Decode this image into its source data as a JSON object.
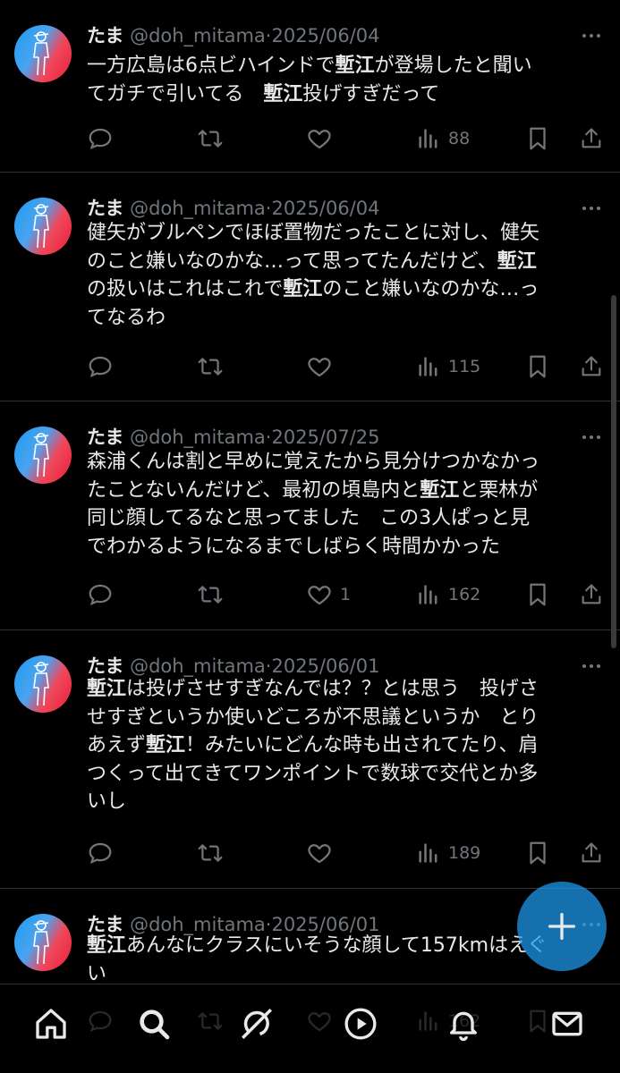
{
  "tweets": [
    {
      "name": "たま",
      "handle": "@doh_mitama",
      "date": "2025/06/04",
      "segments": [
        {
          "t": "一方広島は6点ビハインドで"
        },
        {
          "t": "塹江",
          "b": true
        },
        {
          "t": "が登場したと聞い\nてガチで引いてる　"
        },
        {
          "t": "塹江",
          "b": true
        },
        {
          "t": "投げすぎだって"
        }
      ],
      "likes": "",
      "views": "88"
    },
    {
      "name": "たま",
      "handle": "@doh_mitama",
      "date": "2025/06/04",
      "segments": [
        {
          "t": "健矢がブルペンでほぼ置物だったことに対し、健矢\nのこと嫌いなのかな…って思ってたんだけど、"
        },
        {
          "t": "塹江",
          "b": true
        },
        {
          "t": "\nの扱いはこれはこれで"
        },
        {
          "t": "塹江",
          "b": true
        },
        {
          "t": "のこと嫌いなのかな…っ\nてなるわ"
        }
      ],
      "likes": "",
      "views": "115"
    },
    {
      "name": "たま",
      "handle": "@doh_mitama",
      "date": "2025/07/25",
      "segments": [
        {
          "t": "森浦くんは割と早めに覚えたから見分けつかなかっ\nたことないんだけど、最初の頃島内と"
        },
        {
          "t": "塹江",
          "b": true
        },
        {
          "t": "と栗林が\n同じ顔してるなと思ってました　この3人ぱっと見\nでわかるようになるまでしばらく時間かかった"
        }
      ],
      "likes": "1",
      "views": "162"
    },
    {
      "name": "たま",
      "handle": "@doh_mitama",
      "date": "2025/06/01",
      "segments": [
        {
          "t": "塹江",
          "b": true
        },
        {
          "t": "は投げさせすぎなんでは？？とは思う　投げさ\nせすぎというか使いどころが不思議というか　とり\nあえず"
        },
        {
          "t": "塹江",
          "b": true
        },
        {
          "t": "！みたいにどんな時も出されてたり、肩\nつくって出てきてワンポイントで数球で交代とか多\nいし"
        }
      ],
      "likes": "",
      "views": "189"
    },
    {
      "name": "たま",
      "handle": "@doh_mitama",
      "date": "2025/06/01",
      "segments": [
        {
          "t": "塹江",
          "b": true
        },
        {
          "t": "あんなにクラスにいそうな顔して157kmはえぐ\nい"
        }
      ],
      "likes": "",
      "views": "162"
    }
  ],
  "header_separator": "·",
  "fab": {
    "icon": "plus-icon"
  },
  "tabbar": {
    "items": [
      {
        "name": "home",
        "icon": "home-icon"
      },
      {
        "name": "search",
        "icon": "search-icon"
      },
      {
        "name": "grok",
        "icon": "grok-icon"
      },
      {
        "name": "video",
        "icon": "play-icon"
      },
      {
        "name": "notifications",
        "icon": "bell-icon"
      },
      {
        "name": "messages",
        "icon": "mail-icon"
      }
    ]
  },
  "colors": {
    "background": "#000000",
    "text": "#e7e9ea",
    "muted": "#71767b",
    "accent": "#1d9bf0",
    "divider": "#2f3336"
  }
}
